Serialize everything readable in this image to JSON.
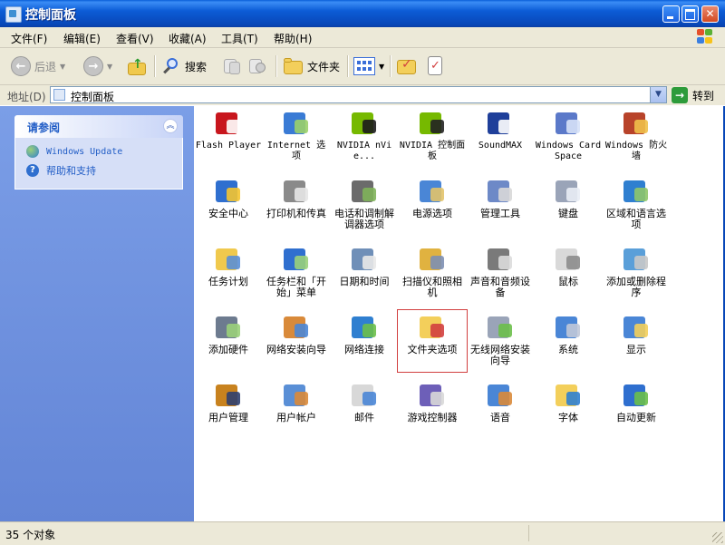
{
  "window": {
    "title": "控制面板"
  },
  "menubar": {
    "items": [
      "文件(F)",
      "编辑(E)",
      "查看(V)",
      "收藏(A)",
      "工具(T)",
      "帮助(H)"
    ]
  },
  "toolbar": {
    "back_label": "后退",
    "search_label": "搜索",
    "folders_label": "文件夹"
  },
  "address": {
    "label": "地址(D)",
    "value": "控制面板",
    "go_label": "转到"
  },
  "sidebar": {
    "see_also_title": "请参阅",
    "links": [
      {
        "label": "Windows Update",
        "icon": "windows-update-icon"
      },
      {
        "label": "帮助和支持",
        "icon": "help-icon"
      }
    ]
  },
  "items": [
    {
      "label": "Flash Player",
      "icon": "flash-player-icon"
    },
    {
      "label": "Internet 选项",
      "icon": "internet-options-icon"
    },
    {
      "label": "NVIDIA nVie...",
      "icon": "nvidia-nview-icon"
    },
    {
      "label": "NVIDIA 控制面板",
      "icon": "nvidia-control-panel-icon"
    },
    {
      "label": "SoundMAX",
      "icon": "soundmax-icon"
    },
    {
      "label": "Windows CardSpace",
      "icon": "cardspace-icon"
    },
    {
      "label": "Windows 防火墙",
      "icon": "firewall-icon"
    },
    {
      "label": "安全中心",
      "icon": "security-center-icon"
    },
    {
      "label": "打印机和传真",
      "icon": "printer-icon"
    },
    {
      "label": "电话和调制解调器选项",
      "icon": "phone-modem-icon"
    },
    {
      "label": "电源选项",
      "icon": "power-options-icon"
    },
    {
      "label": "管理工具",
      "icon": "admin-tools-icon"
    },
    {
      "label": "键盘",
      "icon": "keyboard-icon"
    },
    {
      "label": "区域和语言选项",
      "icon": "region-language-icon"
    },
    {
      "label": "任务计划",
      "icon": "scheduled-tasks-icon"
    },
    {
      "label": "任务栏和「开始」菜单",
      "icon": "taskbar-start-menu-icon"
    },
    {
      "label": "日期和时间",
      "icon": "date-time-icon"
    },
    {
      "label": "扫描仪和照相机",
      "icon": "scanner-camera-icon"
    },
    {
      "label": "声音和音频设备",
      "icon": "sound-audio-icon"
    },
    {
      "label": "鼠标",
      "icon": "mouse-icon"
    },
    {
      "label": "添加或删除程序",
      "icon": "add-remove-programs-icon"
    },
    {
      "label": "添加硬件",
      "icon": "add-hardware-icon"
    },
    {
      "label": "网络安装向导",
      "icon": "network-setup-wizard-icon"
    },
    {
      "label": "网络连接",
      "icon": "network-connections-icon"
    },
    {
      "label": "文件夹选项",
      "icon": "folder-options-icon"
    },
    {
      "label": "无线网络安装向导",
      "icon": "wireless-wizard-icon"
    },
    {
      "label": "系统",
      "icon": "system-icon"
    },
    {
      "label": "显示",
      "icon": "display-icon"
    },
    {
      "label": "用户管理",
      "icon": "user-management-icon"
    },
    {
      "label": "用户帐户",
      "icon": "user-accounts-icon"
    },
    {
      "label": "邮件",
      "icon": "mail-icon"
    },
    {
      "label": "游戏控制器",
      "icon": "game-controllers-icon"
    },
    {
      "label": "语音",
      "icon": "speech-icon"
    },
    {
      "label": "字体",
      "icon": "fonts-icon"
    },
    {
      "label": "自动更新",
      "icon": "automatic-updates-icon"
    }
  ],
  "selected_item": "文件夹选项",
  "status": {
    "text": "35 个对象"
  },
  "colors": {
    "titlebar": "#0a5fd8",
    "sidebar": "#7b9ee7",
    "selection_outline": "#d23f3f"
  }
}
